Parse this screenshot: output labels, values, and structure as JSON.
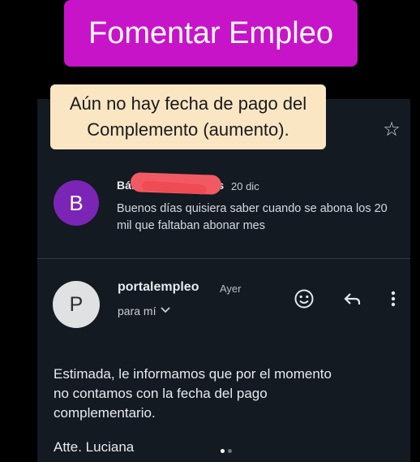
{
  "overlay": {
    "title": "Fomentar Empleo",
    "note_line1": "Aún no hay fecha de pago del",
    "note_line2": "Complemento (aumento)."
  },
  "thread": {
    "message1": {
      "avatar_letter": "B",
      "sender": "Bár",
      "sender_tail": "s",
      "date": "20 dic",
      "snippet": "Buenos días quisiera saber cuando se abona los 20 mil que faltaban abonar mes"
    },
    "message2": {
      "avatar_letter": "P",
      "sender": "portalempleo",
      "date": "Ayer",
      "recipient": "para mí",
      "body_line1": "Estimada, le informamos que por el momento",
      "body_line2": "no contamos con la fecha del pago",
      "body_line3": "complementario.",
      "signature": "Atte. Luciana"
    }
  },
  "icons": {
    "star": "star-icon",
    "emoji": "emoji-reaction-icon",
    "reply": "reply-icon",
    "more": "more-vert-icon",
    "expand": "chevron-down-icon"
  },
  "colors": {
    "banner": "#c814c8",
    "note": "#fbe6c4",
    "avatar_b": "#7a25b6",
    "card": "#131a22",
    "redaction": "#f25a63"
  }
}
